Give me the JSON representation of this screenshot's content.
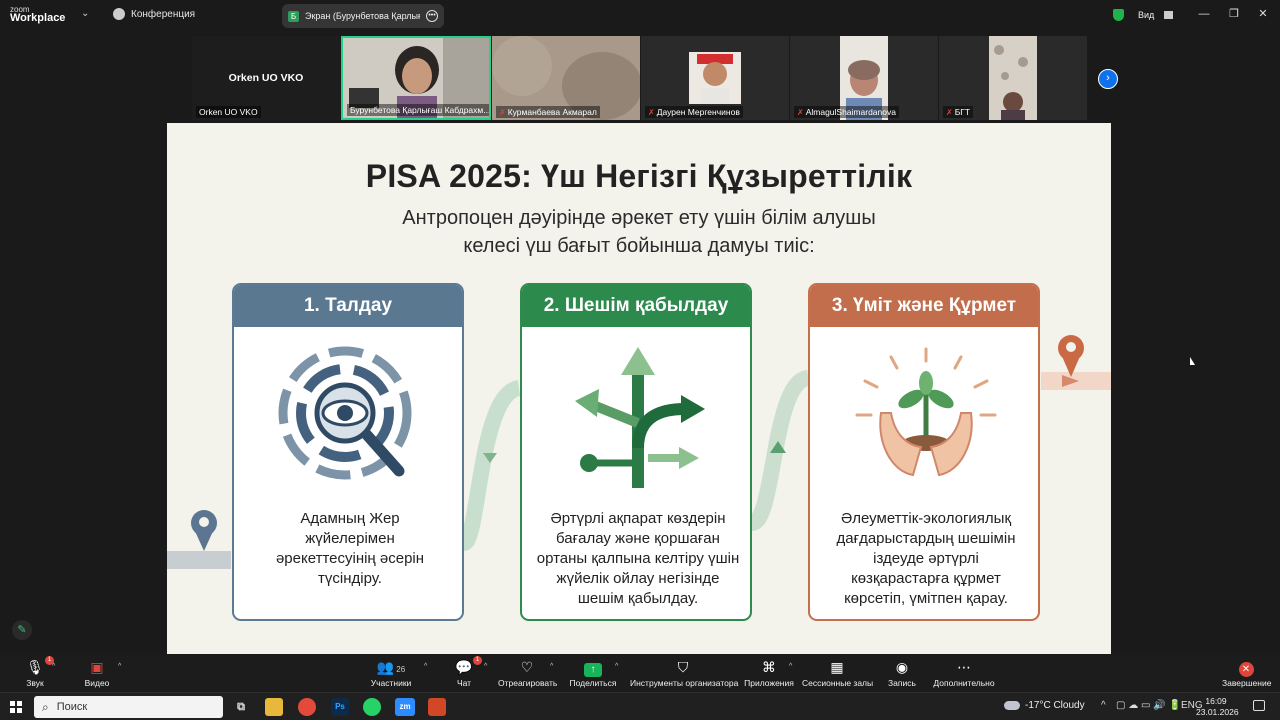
{
  "app": {
    "logo_top": "zoom",
    "logo_bottom": "Workplace",
    "conference_label": "Конференция",
    "share_tab_label": "Экран (Бурунбетова Қарлығаш Кабдрахм",
    "view_label": "Вид"
  },
  "participants": {
    "self_big": "Orken UO VKO",
    "self_small": "Orken UO VKO",
    "tiles": [
      {
        "name": "Бурунбетова Қарлығаш Кабдрахм...",
        "muted": false
      },
      {
        "name": "Курманбаева Акмарал",
        "muted": true
      },
      {
        "name": "Даурен Мергенчинов",
        "muted": true
      },
      {
        "name": "AlmagulShaimardanova",
        "muted": true
      },
      {
        "name": "БГТ",
        "muted": true
      }
    ]
  },
  "slide": {
    "title": "PISA 2025: Үш Негізгі Құзыреттілік",
    "subtitle_line1": "Антропоцен дәуірінде әрекет ету үшін білім алушы",
    "subtitle_line2": "келесі үш бағыт бойынша дамуы тиіс:",
    "cards": [
      {
        "header": "1. Талдау",
        "icon": "analysis-eye-magnifier-icon",
        "lines": [
          "Адамның Жер",
          "жүйелерімен",
          "әрекеттесуінің әсерін",
          "түсіндіру."
        ],
        "color": "#5b7891"
      },
      {
        "header": "2. Шешім қабылдау",
        "icon": "decision-arrows-icon",
        "lines": [
          "Әртүрлі ақпарат көздерін",
          "бағалау және қоршаған",
          "ортаны қалпына келтіру үшін",
          "жүйелік ойлау негізінде",
          "шешім қабылдау."
        ],
        "color": "#2c8a4c"
      },
      {
        "header": "3. Үміт және Құрмет",
        "icon": "hands-sprout-icon",
        "lines": [
          "Әлеуметтік-экологиялық",
          "дағдарыстардың шешімін",
          "іздеуде әртүрлі",
          "көзқарастарға құрмет",
          "көрсетіп, үмітпен қарау."
        ],
        "color": "#c26d4b"
      }
    ]
  },
  "toolbar": {
    "audio": "Звук",
    "video": "Видео",
    "participants": "Участники",
    "participants_count": "26",
    "chat": "Чат",
    "chat_badge": "1",
    "audio_badge": "1",
    "react": "Отреагировать",
    "share": "Поделиться",
    "host_tools": "Инструменты организатора",
    "apps": "Приложения",
    "breakout": "Сессионные залы",
    "record": "Запись",
    "more": "Дополнительно",
    "end": "Завершение"
  },
  "taskbar": {
    "search_placeholder": "Поиск",
    "weather": "-17°C  Cloudy",
    "lang": "ENG",
    "time": "16:09",
    "date": "23.01.2026",
    "apps": [
      {
        "name": "task-view",
        "label": ""
      },
      {
        "name": "file-explorer",
        "label": ""
      },
      {
        "name": "chrome",
        "label": ""
      },
      {
        "name": "photoshop",
        "label": "Ps"
      },
      {
        "name": "whatsapp",
        "label": ""
      },
      {
        "name": "zoom",
        "label": "zm"
      },
      {
        "name": "powerpoint",
        "label": ""
      }
    ]
  },
  "colors": {
    "active_speaker": "#23d18b",
    "share_green": "#19b35a",
    "end_red": "#e0453b",
    "zoom_blue": "#0e72ed"
  }
}
